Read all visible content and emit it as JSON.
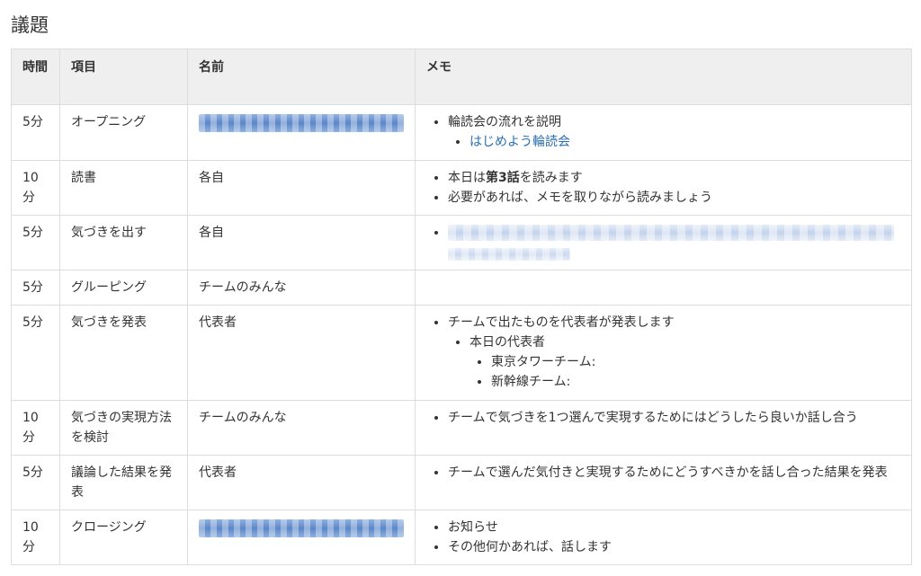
{
  "title": "議題",
  "columns": [
    "時間",
    "項目",
    "名前",
    "メモ"
  ],
  "rows": [
    {
      "time": "5分",
      "item": "オープニング",
      "name": "",
      "memo": [
        "輪読会の流れを説明"
      ],
      "memo_sub": [
        "はじめよう輪読会"
      ]
    },
    {
      "time": "10分",
      "item": "読書",
      "name": "各自",
      "memo_rich": {
        "pre": "本日は",
        "bold": "第3話",
        "post": "を読みます"
      },
      "memo": [
        "必要があれば、メモを取りながら読みましょう"
      ]
    },
    {
      "time": "5分",
      "item": "気づきを出す",
      "name": "各自",
      "memo": []
    },
    {
      "time": "5分",
      "item": "グルーピング",
      "name": "チームのみんな",
      "memo": []
    },
    {
      "time": "5分",
      "item": "気づきを発表",
      "name": "代表者",
      "memo": [
        "チームで出たものを代表者が発表します"
      ],
      "memo_sub": [
        "本日の代表者"
      ],
      "memo_sub_sub": [
        "東京タワーチーム:",
        "新幹線チーム:"
      ]
    },
    {
      "time": "10分",
      "item": "気づきの実現方法を検討",
      "name": "チームのみんな",
      "memo": [
        "チームで気づきを1つ選んで実現するためにはどうしたら良いか話し合う"
      ]
    },
    {
      "time": "5分",
      "item": "議論した結果を発表",
      "name": "代表者",
      "memo": [
        "チームで選んだ気付きと実現するためにどうすべきかを話し合った結果を発表"
      ]
    },
    {
      "time": "10分",
      "item": "クロージング",
      "name": "",
      "memo": [
        "お知らせ",
        "その他何かあれば、話します"
      ]
    }
  ]
}
